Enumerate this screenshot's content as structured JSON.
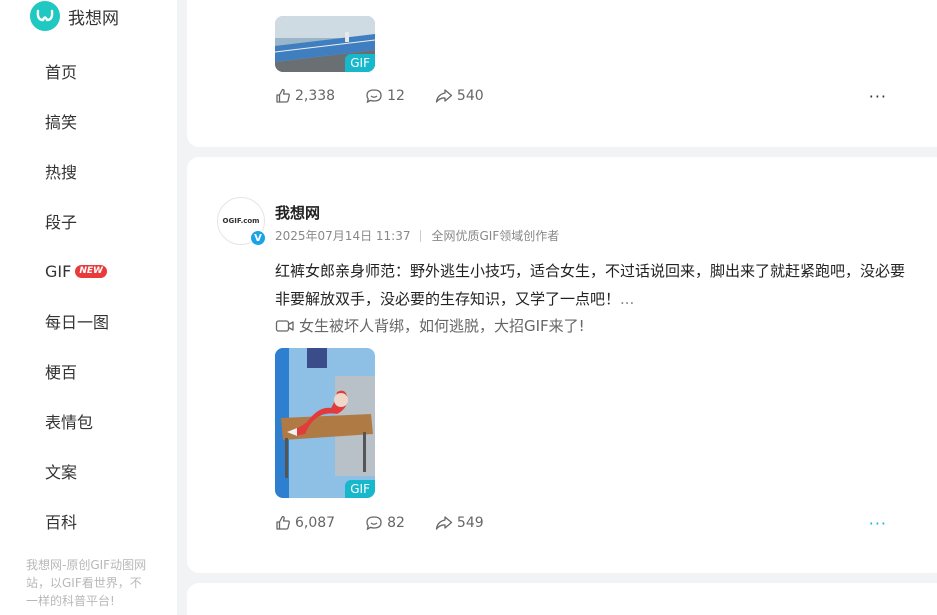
{
  "sidebar": {
    "logo_text": "我想网",
    "items": [
      {
        "label": "首页"
      },
      {
        "label": "搞笑"
      },
      {
        "label": "热搜"
      },
      {
        "label": "段子"
      },
      {
        "label": "GIF",
        "badge": "NEW"
      },
      {
        "label": "每日一图"
      },
      {
        "label": "梗百"
      },
      {
        "label": "表情包"
      },
      {
        "label": "文案"
      },
      {
        "label": "百科"
      }
    ],
    "footer": "我想网-原创GIF动图网站，以GIF看世界，不一样的科普平台!"
  },
  "posts": [
    {
      "gif_tag": "GIF",
      "likes": "2,338",
      "comments": "12",
      "shares": "540",
      "more": "···"
    },
    {
      "author": "我想网",
      "avatar_logo": "OGIF.com",
      "verified": "V",
      "date": "2025年07月14日 11:37",
      "author_desc": "全网优质GIF领域创作者",
      "text": "红裤女郎亲身师范：野外逃生小技巧，适合女生，不过话说回来，脚出来了就赶紧跑吧，没必要非要解放双手，没必要的生存知识，又学了一点吧！",
      "ellipsis": "...",
      "video_title": "女生被坏人背绑，如何逃脱，大招GIF来了!",
      "gif_tag": "GIF",
      "likes": "6,087",
      "comments": "82",
      "shares": "549",
      "more": "···"
    }
  ],
  "colors": {
    "brand": "#1fc8c0",
    "gif_tag": "#17b8cc",
    "new_badge": "#e83b3b",
    "verified": "#1aa3e8",
    "more_active": "#17b8cc"
  },
  "icons": [
    "logo-icon",
    "like-icon",
    "comment-icon",
    "share-icon",
    "more-icon",
    "video-icon",
    "verified-icon"
  ]
}
